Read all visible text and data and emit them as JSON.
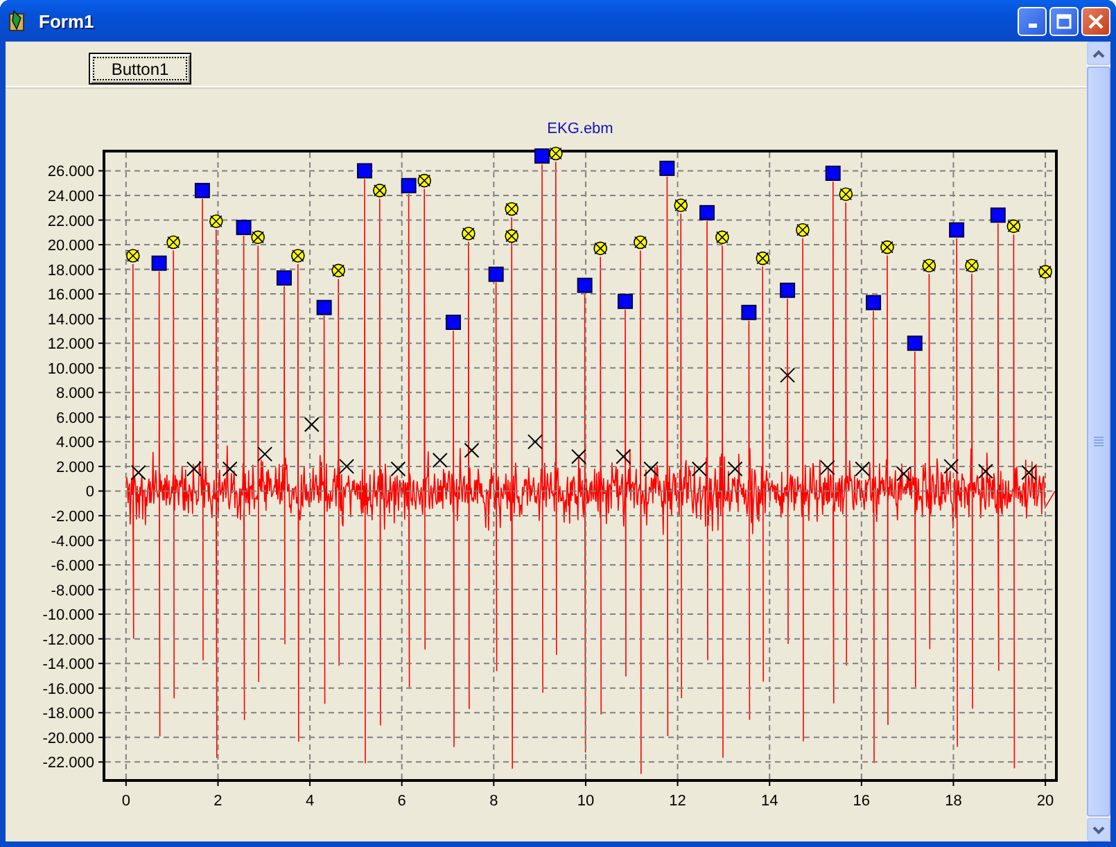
{
  "window": {
    "title": "Form1"
  },
  "toolbar": {
    "button": "Button1"
  },
  "chart": {
    "chart_data": {
      "type": "scatter",
      "title": "EKG.ebm",
      "xlim": [
        -0.48,
        20.24
      ],
      "grid": true,
      "ylim": [
        -23500,
        27600
      ],
      "xticks": [
        0,
        2,
        4,
        6,
        8,
        10,
        12,
        14,
        16,
        18,
        20
      ],
      "yticks": [
        {
          "value": 26000,
          "label": "26.000"
        },
        {
          "value": 24000,
          "label": "24.000"
        },
        {
          "value": 22000,
          "label": "22.000"
        },
        {
          "value": 20000,
          "label": "20.000"
        },
        {
          "value": 18000,
          "label": "18.000"
        },
        {
          "value": 16000,
          "label": "16.000"
        },
        {
          "value": 14000,
          "label": "14.000"
        },
        {
          "value": 12000,
          "label": "12.000"
        },
        {
          "value": 10000,
          "label": "10.000"
        },
        {
          "value": 8000,
          "label": "8.000"
        },
        {
          "value": 6000,
          "label": "6.000"
        },
        {
          "value": 4000,
          "label": "4.000"
        },
        {
          "value": 2000,
          "label": "2.000"
        },
        {
          "value": 0,
          "label": "0"
        },
        {
          "value": -2000,
          "label": "-2.000"
        },
        {
          "value": -4000,
          "label": "-4.000"
        },
        {
          "value": -6000,
          "label": "-6.000"
        },
        {
          "value": -8000,
          "label": "-8.000"
        },
        {
          "value": -10000,
          "label": "-10.000"
        },
        {
          "value": -12000,
          "label": "-12.000"
        },
        {
          "value": -14000,
          "label": "-14.000"
        },
        {
          "value": -16000,
          "label": "-16.000"
        },
        {
          "value": -18000,
          "label": "-18.000"
        },
        {
          "value": -20000,
          "label": "-20.000"
        },
        {
          "value": -22000,
          "label": "-22.000"
        }
      ],
      "series": [
        {
          "marker": "square",
          "color": "#0000ff",
          "x": [
            0.72,
            1.66,
            2.56,
            3.44,
            4.31,
            5.19,
            6.15,
            7.12,
            8.05,
            9.05,
            9.98,
            10.86,
            11.77,
            12.64,
            13.55,
            14.39,
            15.38,
            16.26,
            17.16,
            18.07,
            18.97
          ],
          "values": [
            18500,
            24400,
            21400,
            17300,
            14900,
            26000,
            24800,
            13700,
            17600,
            27200,
            16700,
            15400,
            26200,
            22600,
            14500,
            16300,
            25800,
            15300,
            12000,
            21200,
            22400
          ]
        },
        {
          "marker": "circle",
          "color": "#ffff00",
          "x": [
            0.15,
            1.03,
            1.96,
            2.87,
            3.74,
            4.62,
            5.52,
            6.49,
            7.45,
            8.39,
            8.39,
            9.35,
            10.32,
            11.19,
            12.07,
            12.97,
            13.85,
            14.72,
            15.66,
            16.56,
            17.47,
            18.4,
            19.31,
            20.0
          ],
          "values": [
            19100,
            20200,
            21900,
            20600,
            19100,
            17900,
            24400,
            25200,
            20900,
            22900,
            20700,
            27400,
            19700,
            20200,
            23200,
            20600,
            18900,
            21200,
            24100,
            19800,
            18300,
            18300,
            21500,
            17800
          ]
        },
        {
          "marker": "cross",
          "color": "#000000",
          "x": [
            0.27,
            1.48,
            2.26,
            3.02,
            4.04,
            4.8,
            5.92,
            6.83,
            7.52,
            8.9,
            9.85,
            10.82,
            11.42,
            12.47,
            13.25,
            14.39,
            15.26,
            16.02,
            16.92,
            17.95,
            18.7,
            19.64
          ],
          "values": [
            1500,
            1800,
            1800,
            3000,
            5400,
            2000,
            1800,
            2500,
            3300,
            4000,
            2800,
            2800,
            1800,
            1800,
            1800,
            9400,
            1900,
            1800,
            1400,
            2000,
            1600,
            1500
          ]
        }
      ]
    }
  }
}
